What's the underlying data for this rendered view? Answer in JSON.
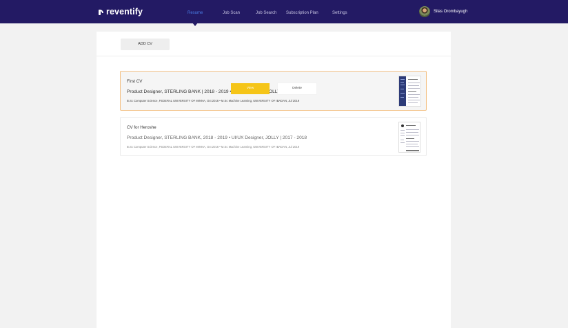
{
  "brand": {
    "name": "reventify"
  },
  "nav": {
    "items": [
      {
        "label": "Resume",
        "active": true
      },
      {
        "label": "Job Scan",
        "active": false
      },
      {
        "label": "Job Search",
        "active": false
      },
      {
        "label": "Subscription Plan",
        "active": false
      },
      {
        "label": "Settings",
        "active": false
      }
    ]
  },
  "user": {
    "name": "Silas Orombayugh"
  },
  "toolbar": {
    "add_cv_label": "ADD CV"
  },
  "cvs": [
    {
      "title": "First CV",
      "roles": "Product Designer, STERLING BANK | 2018 - 2019 • UI/UX Designer, JOLLY | 2017 - 2018",
      "education": "B.Sc Computer Science, FEDERAL UNIVERSITY OF MINNA, Oct 2016 • M.Sc Machine Learning, UNIVERSITY OF IBADAN, Jul 2019",
      "view_label": "View",
      "delete_label": "Delete"
    },
    {
      "title": "CV for Heroshe",
      "roles": "Product Designer, STERLING BANK, 2018 - 2019 • UI/UX Designer, JOLLY | 2017 - 2018",
      "education": "B.Sc Computer Science, FEDERAL UNIVERSITY OF MINNA, Oct 2016 • M.Sc Machine Learning, UNIVERSITY OF IBADAN, Jul 2019"
    }
  ],
  "colors": {
    "topbar": "#231a64",
    "nav_active": "#4a7fe8",
    "view_button": "#f5c518",
    "card_highlight_border": "#f3c082"
  }
}
